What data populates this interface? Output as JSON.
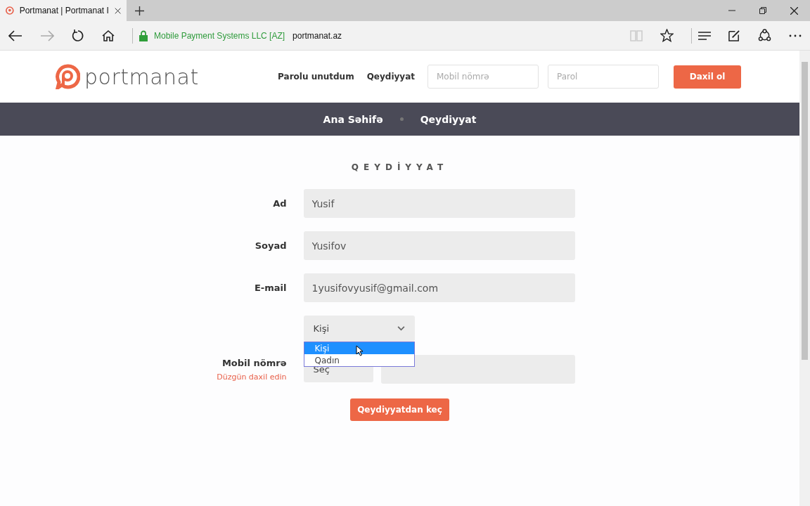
{
  "browser": {
    "tab": {
      "title": "Portmanat | Portmanat I",
      "selected": true
    },
    "identity": "Mobile Payment Systems LLC [AZ]",
    "url": "portmanat.az"
  },
  "header": {
    "logo": "portmanat",
    "links": [
      "Parolu unutdum",
      "Qeydiyyat"
    ],
    "phone_field": {
      "placeholder": "Mobil nömrə"
    },
    "password_field": {
      "placeholder": "Parol"
    },
    "login_button": "Daxil ol"
  },
  "breadcrumbs": [
    "Ana Səhifə",
    "Qeydiyyat"
  ],
  "form": {
    "title": "QEYDİYYAT",
    "fields": [
      {
        "label": "Ad",
        "value": "Yusif"
      },
      {
        "label": "Soyad",
        "value": "Yusifov"
      },
      {
        "label": "E-mail",
        "value": "1yusifovyusif@gmail.com"
      }
    ],
    "gender": {
      "value": "Kişi",
      "options": [
        {
          "label": "Kişi",
          "selected": true
        },
        {
          "label": "Qadın",
          "selected": false
        }
      ]
    },
    "mobile": {
      "label": "Mobil nömrə",
      "error": "Düzgün daxil edin",
      "prefix": "Seç"
    },
    "submit": "Qeydiyyatdan keç"
  }
}
